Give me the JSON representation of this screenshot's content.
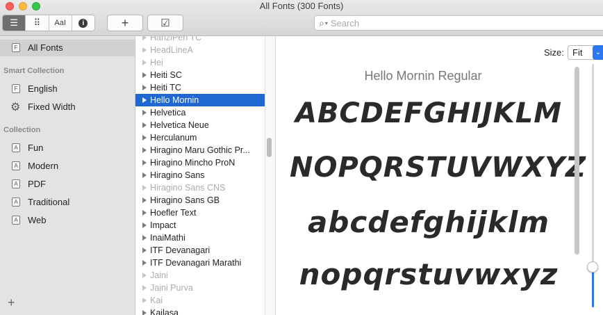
{
  "window": {
    "title": "All Fonts (300 Fonts)"
  },
  "toolbar": {
    "view_modes": [
      {
        "icon": "list-view-icon",
        "glyph": "☰"
      },
      {
        "icon": "grid-view-icon",
        "glyph": "⠿"
      },
      {
        "icon": "sample-view-icon",
        "glyph": "AaI"
      },
      {
        "icon": "info-icon",
        "glyph": "i"
      }
    ],
    "add_glyph": "+",
    "check_glyph": "☑",
    "search_placeholder": "Search",
    "search_icon": "⌕"
  },
  "sidebar": {
    "all_fonts": {
      "label": "All Fonts",
      "icon_letter": "F"
    },
    "smart_collection_header": "Smart Collection",
    "smart_collections": [
      {
        "label": "English",
        "icon": "font-collection-icon",
        "icon_letter": "F"
      },
      {
        "label": "Fixed Width",
        "icon": "gear-icon",
        "icon_letter": "⚙"
      }
    ],
    "collection_header": "Collection",
    "collections": [
      {
        "label": "Fun",
        "icon_letter": "A"
      },
      {
        "label": "Modern",
        "icon_letter": "A"
      },
      {
        "label": "PDF",
        "icon_letter": "A"
      },
      {
        "label": "Traditional",
        "icon_letter": "A"
      },
      {
        "label": "Web",
        "icon_letter": "A"
      }
    ],
    "add_glyph": "+"
  },
  "font_list": [
    {
      "name": "HanziPen TC",
      "dim": true
    },
    {
      "name": "HeadLineA",
      "dim": true
    },
    {
      "name": "Hei",
      "dim": true
    },
    {
      "name": "Heiti SC",
      "dim": false
    },
    {
      "name": "Heiti TC",
      "dim": false
    },
    {
      "name": "Hello Mornin",
      "dim": false,
      "selected": true
    },
    {
      "name": "Helvetica",
      "dim": false
    },
    {
      "name": "Helvetica Neue",
      "dim": false
    },
    {
      "name": "Herculanum",
      "dim": false
    },
    {
      "name": "Hiragino Maru Gothic Pr...",
      "dim": false
    },
    {
      "name": "Hiragino Mincho ProN",
      "dim": false
    },
    {
      "name": "Hiragino Sans",
      "dim": false
    },
    {
      "name": "Hiragino Sans CNS",
      "dim": true
    },
    {
      "name": "Hiragino Sans GB",
      "dim": false
    },
    {
      "name": "Hoefler Text",
      "dim": false
    },
    {
      "name": "Impact",
      "dim": false
    },
    {
      "name": "InaiMathi",
      "dim": false
    },
    {
      "name": "ITF Devanagari",
      "dim": false
    },
    {
      "name": "ITF Devanagari Marathi",
      "dim": false
    },
    {
      "name": "Jaini",
      "dim": true
    },
    {
      "name": "Jaini Purva",
      "dim": true
    },
    {
      "name": "Kai",
      "dim": true
    },
    {
      "name": "Kailasa",
      "dim": false
    }
  ],
  "preview": {
    "size_label": "Size:",
    "size_value": "Fit",
    "size_arrow": "⌄",
    "font_title": "Hello Mornin Regular",
    "sample_lines": [
      "ABCDEFGHIJKLM",
      "NOPQRSTUVWXYZ",
      "abcdefghijklm",
      "nopqrstuvwxyz"
    ]
  }
}
